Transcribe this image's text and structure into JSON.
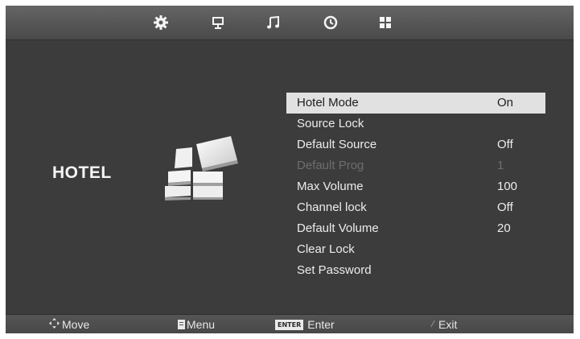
{
  "top_tabs": [
    {
      "icon": "gear-icon"
    },
    {
      "icon": "monitor-icon"
    },
    {
      "icon": "music-note-icon"
    },
    {
      "icon": "clock-icon"
    },
    {
      "icon": "grid-icon"
    }
  ],
  "page": {
    "title": "HOTEL",
    "graphic_icon": "hotel-blocks-icon"
  },
  "menu": {
    "items": [
      {
        "label": "Hotel Mode",
        "value": "On"
      },
      {
        "label": "Source Lock",
        "value": ""
      },
      {
        "label": "Default Source",
        "value": "Off"
      },
      {
        "label": "Default Prog",
        "value": "1"
      },
      {
        "label": "Max Volume",
        "value": "100"
      },
      {
        "label": "Channel lock",
        "value": "Off"
      },
      {
        "label": "Default Volume",
        "value": "20"
      },
      {
        "label": "Clear Lock",
        "value": ""
      },
      {
        "label": "Set Password",
        "value": ""
      }
    ],
    "selected_index": 0,
    "disabled_index": 3
  },
  "footer": {
    "move": {
      "label": "Move",
      "icon": "dpad-icon"
    },
    "menu": {
      "label": "Menu",
      "icon": "menu-icon"
    },
    "enter": {
      "key": "ENTER",
      "label": "Enter"
    },
    "exit": {
      "label": "Exit",
      "icon": "exit-icon"
    }
  },
  "colors": {
    "background": "#3c3c3c",
    "selected_row": "#e1e1e1",
    "text": "#ececec",
    "disabled_text": "#6e6e6e"
  }
}
